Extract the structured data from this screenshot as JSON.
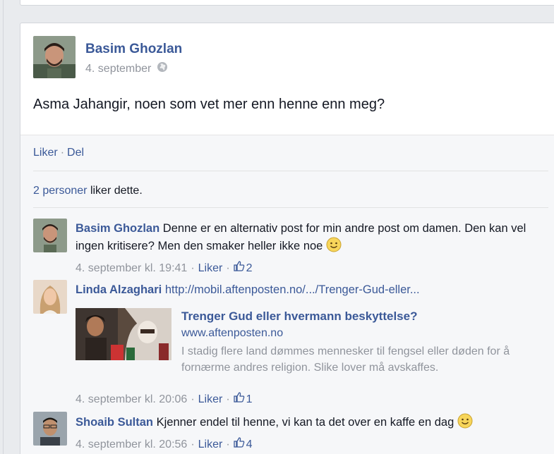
{
  "post": {
    "author": "Basim Ghozlan",
    "date": "4. september",
    "text": "Asma Jahangir, noen som vet mer enn henne enn meg?",
    "actions": {
      "like": "Liker",
      "separator": "·",
      "share": "Del"
    },
    "likes": {
      "count_link": "2 personer",
      "suffix": " liker dette."
    }
  },
  "comments": [
    {
      "author": "Basim Ghozlan",
      "text": "Denne er en alternativ post for min andre post om damen. Den kan vel ingen kritisere? Men den smaker heller ikke noe",
      "timestamp": "4. september kl. 19:41",
      "like_label": "Liker",
      "like_count": "2"
    },
    {
      "author": "Linda Alzaghari",
      "text": "http://mobil.aftenposten.no/.../Trenger-Gud-eller...",
      "share": {
        "title": "Trenger Gud eller hvermann beskyttelse?",
        "url": "www.aftenposten.no",
        "description": "I stadig flere land dømmes mennesker til fengsel eller døden for å fornærme andres religion. Slike lover må avskaffes."
      },
      "timestamp": "4. september kl. 20:06",
      "like_label": "Liker",
      "like_count": "1"
    },
    {
      "author": "Shoaib Sultan",
      "text": "Kjenner endel til henne, vi kan ta det over en kaffe en dag",
      "timestamp": "4. september kl. 20:56",
      "like_label": "Liker",
      "like_count": "4"
    }
  ],
  "meta_separator": "·",
  "colors": {
    "link": "#3b5998",
    "muted": "#90949c",
    "background": "#e9ebee"
  }
}
